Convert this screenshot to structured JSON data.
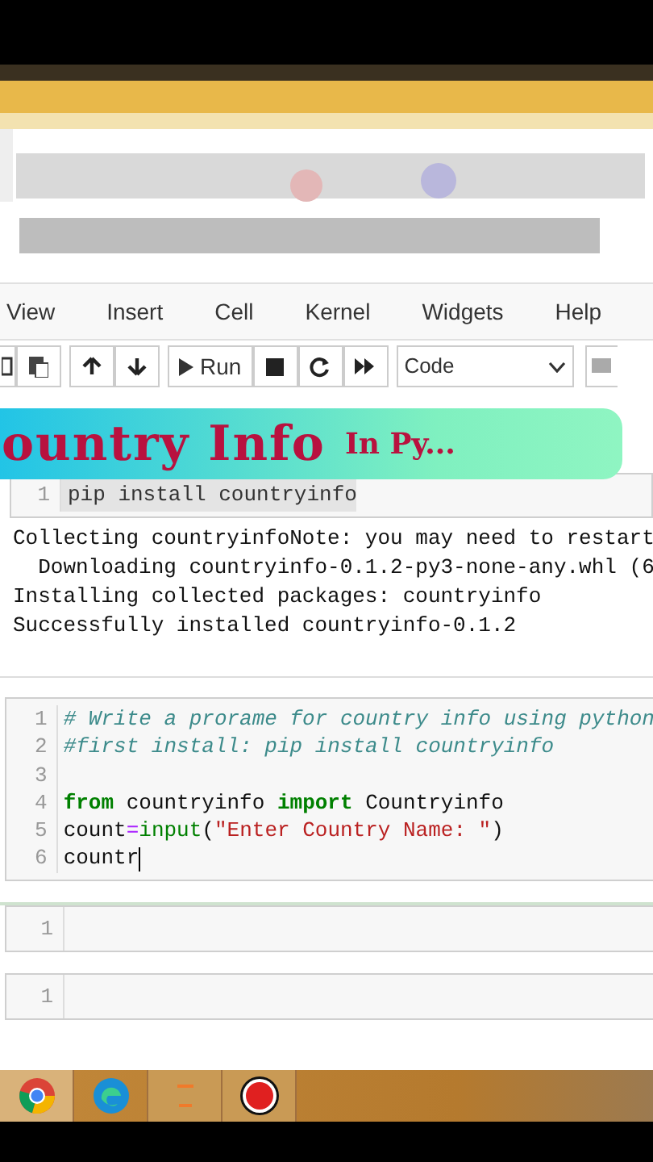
{
  "menu": [
    {
      "label": "View"
    },
    {
      "label": "Insert"
    },
    {
      "label": "Cell"
    },
    {
      "label": "Kernel"
    },
    {
      "label": "Widgets"
    },
    {
      "label": "Help"
    }
  ],
  "toolbar": {
    "run_label": "Run",
    "cell_type": "Code"
  },
  "banner": {
    "title": "ountry Info",
    "tail": "In Py..."
  },
  "install_cell": {
    "line_number": "1",
    "code": "pip install countryinfo"
  },
  "output": [
    "Collecting countryinfoNote: you may need to restart",
    "  Downloading countryinfo-0.1.2-py3-none-any.whl (6",
    "Installing collected packages: countryinfo",
    "Successfully installed countryinfo-0.1.2"
  ],
  "code_cell": {
    "lines": [
      {
        "number": "1",
        "tokens": [
          {
            "kind": "comment",
            "text": "# Write a prorame for country info using python"
          }
        ]
      },
      {
        "number": "2",
        "tokens": [
          {
            "kind": "comment",
            "text": "#first install: pip install countryinfo"
          }
        ]
      },
      {
        "number": "3"
      },
      {
        "number": "4",
        "tokens": [
          {
            "kind": "keyword",
            "text": "from"
          },
          {
            "kind": "plain",
            "text": " countryinfo "
          },
          {
            "kind": "keyword",
            "text": "import"
          },
          {
            "kind": "plain",
            "text": " Countryinfo"
          }
        ]
      },
      {
        "number": "5",
        "tokens": [
          {
            "kind": "plain",
            "text": "count"
          },
          {
            "kind": "operator",
            "text": "="
          },
          {
            "kind": "builtin",
            "text": "input"
          },
          {
            "kind": "plain",
            "text": "("
          },
          {
            "kind": "string",
            "text": "\"Enter Country Name: \""
          },
          {
            "kind": "plain",
            "text": ")"
          }
        ]
      },
      {
        "number": "6",
        "tokens": [
          {
            "kind": "plain",
            "text": "countr"
          }
        ],
        "cursor": true
      }
    ]
  },
  "empty_cells": [
    {
      "line_number": "1"
    },
    {
      "line_number": "1"
    }
  ],
  "taskbar": [
    {
      "kind": "chrome"
    },
    {
      "kind": "edge"
    },
    {
      "kind": "app"
    },
    {
      "kind": "recorder"
    }
  ]
}
